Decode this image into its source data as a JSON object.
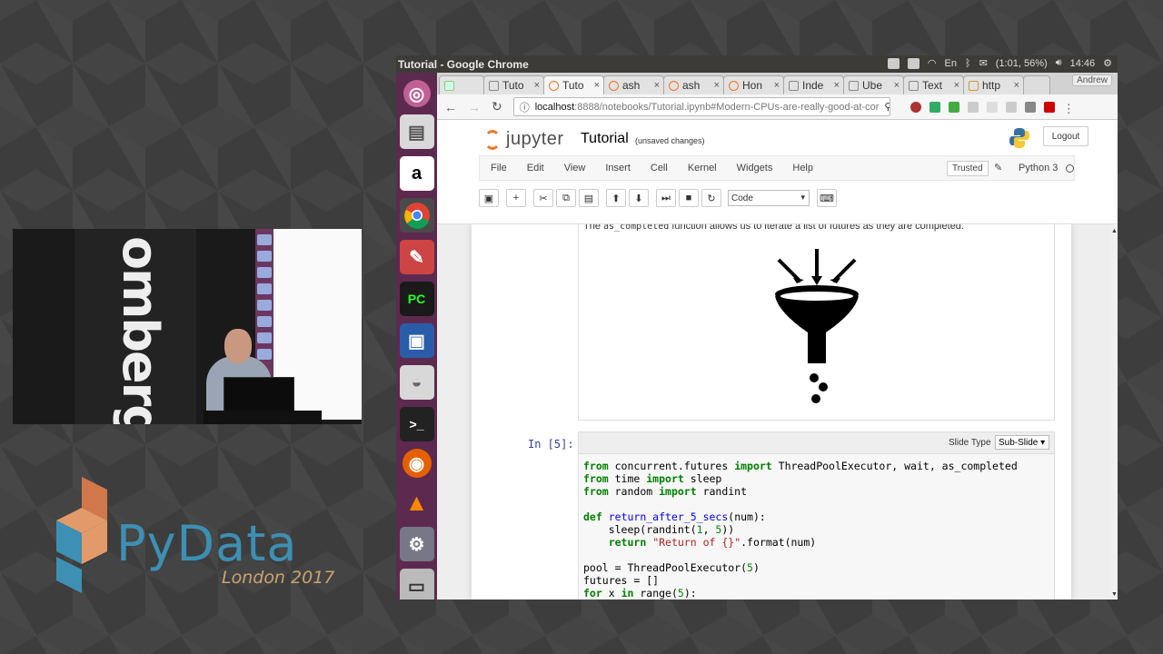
{
  "window": {
    "title": "Tutorial - Google Chrome"
  },
  "tray": {
    "lang": "En",
    "battery": "(1:01, 56%)",
    "time": "14:46"
  },
  "tabs": [
    {
      "label": "Tuto"
    },
    {
      "label": "Tuto"
    },
    {
      "label": "ash"
    },
    {
      "label": "ash"
    },
    {
      "label": "Hon"
    },
    {
      "label": "Inde"
    },
    {
      "label": "Ube"
    },
    {
      "label": "Text"
    },
    {
      "label": "http"
    }
  ],
  "browser": {
    "user": "Andrew",
    "url_host": "localhost",
    "url_path": ":8888/notebooks/Tutorial.ipynb#Modern-CPUs-are-really-good-at-cor"
  },
  "jupyter": {
    "logo": "jupyter",
    "notebook_name": "Tutorial",
    "save_status": "(unsaved changes)",
    "logout": "Logout",
    "menu": [
      "File",
      "Edit",
      "View",
      "Insert",
      "Cell",
      "Kernel",
      "Widgets",
      "Help"
    ],
    "trusted": "Trusted",
    "kernel": "Python 3",
    "cell_type": "Code"
  },
  "cells": {
    "markdown_before": "The ",
    "markdown_code": "as_completed",
    "markdown_after": " function allows us to iterate a list of futures as they are completed.",
    "prompt": "In [5]:",
    "slide_type_label": "Slide Type",
    "slide_type_value": "Sub-Slide ▾"
  },
  "camera": {
    "brand": "omberg"
  },
  "branding": {
    "name": "PyData",
    "event": "London 2017"
  }
}
